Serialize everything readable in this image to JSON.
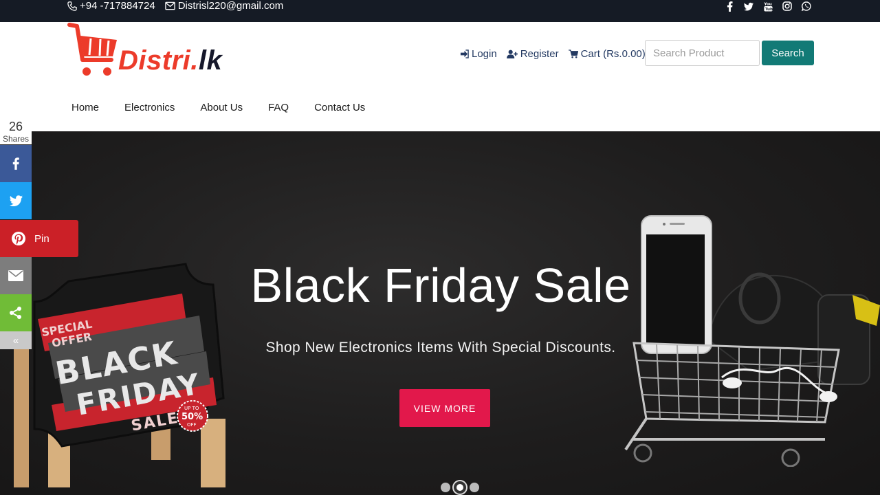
{
  "topbar": {
    "phone": "+94 -717884724",
    "email": "Distrisl220@gmail.com",
    "social_icons": [
      "facebook-icon",
      "twitter-icon",
      "youtube-icon",
      "instagram-icon",
      "whatsapp-icon"
    ]
  },
  "header": {
    "logo_part1": "Distri.",
    "logo_part2": "lk",
    "login": "Login",
    "register": "Register",
    "cart": "Cart (Rs.0.00)",
    "search_placeholder": "Search Product",
    "search_button": "Search"
  },
  "nav": {
    "items": [
      "Home",
      "Electronics",
      "About Us",
      "FAQ",
      "Contact Us"
    ]
  },
  "hero": {
    "title": "Black Friday Sale",
    "subtitle": "Shop New Electronics Items With Special Discounts.",
    "cta": "VIEW MORE",
    "slides": 3,
    "active_slide": 2,
    "sign_line1": "SPECIAL",
    "sign_line2": "OFFER",
    "sign_line3": "BLACK",
    "sign_line4": "FRIDAY",
    "sign_line5": "SALE",
    "sign_badge1": "UP TO",
    "sign_badge2": "50%",
    "sign_badge3": "OFF"
  },
  "share": {
    "count": "26",
    "count_label": "Shares",
    "pin_label": "Pin",
    "collapse": "«"
  },
  "colors": {
    "topbar": "#151b25",
    "search_button": "#127a76",
    "cta": "#e2184b",
    "logo_red": "#ec3b2a"
  }
}
